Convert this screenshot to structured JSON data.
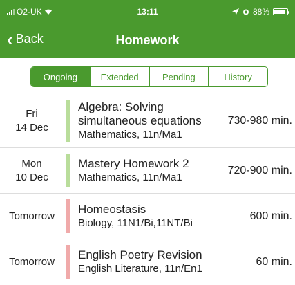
{
  "status_bar": {
    "carrier": "O2-UK",
    "time": "13:11",
    "battery": "88%"
  },
  "nav": {
    "back_label": "Back",
    "title": "Homework"
  },
  "tabs": [
    {
      "label": "Ongoing",
      "active": true
    },
    {
      "label": "Extended",
      "active": false
    },
    {
      "label": "Pending",
      "active": false
    },
    {
      "label": "History",
      "active": false
    }
  ],
  "homework": [
    {
      "day": "Fri",
      "date": "14 Dec",
      "title": "Algebra: Solving simultaneous equations",
      "subject": "Mathematics, 11n/Ma1",
      "duration": "730-980 min.",
      "bar_color": "#b9dd9b"
    },
    {
      "day": "Mon",
      "date": "10 Dec",
      "title": "Mastery Homework 2",
      "subject": "Mathematics, 11n/Ma1",
      "duration": "720-900 min.",
      "bar_color": "#b9dd9b"
    },
    {
      "day": "Tomorrow",
      "date": "",
      "title": "Homeostasis",
      "subject": "Biology, 11N1/Bi,11NT/Bi",
      "duration": "600 min.",
      "bar_color": "#f0aaaa"
    },
    {
      "day": "Tomorrow",
      "date": "",
      "title": "English Poetry Revision",
      "subject": "English Literature, 11n/En1",
      "duration": "60 min.",
      "bar_color": "#f0aaaa"
    }
  ],
  "colors": {
    "brand": "#4a9a2e",
    "on_time": "#b9dd9b",
    "due_soon": "#f0aaaa"
  },
  "icons": [
    "signal-icon",
    "wifi-icon",
    "location-icon",
    "alarm-icon",
    "battery-icon",
    "chevron-left-icon"
  ]
}
